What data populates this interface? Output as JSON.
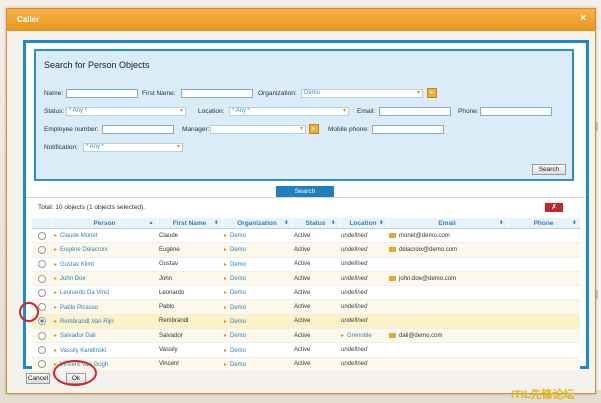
{
  "dialog": {
    "title": "Caller",
    "close": "×"
  },
  "search_panel": {
    "title": "Search for Person Objects",
    "labels": {
      "name": "Name:",
      "first_name": "First Name:",
      "organization": "Organization:",
      "status": "Status:",
      "location": "Location:",
      "email": "Email:",
      "phone": "Phone:",
      "employee_number": "Employee number:",
      "manager": "Manager:",
      "mobile_phone": "Mobile phone:",
      "notification": "Notification:"
    },
    "values": {
      "organization": "Demo",
      "status": "* Any *",
      "location": "* Any *",
      "notification": "* Any *",
      "name": "",
      "first_name": "",
      "email": "",
      "phone": "",
      "employee_number": "",
      "manager": "",
      "mobile_phone": ""
    },
    "search_button": "Search"
  },
  "search_tab": "Search",
  "results": {
    "total": "Total: 10 objects (1 objects selected).",
    "columns": [
      "Person",
      "First Name",
      "Organization",
      "Status",
      "Location",
      "Email",
      "Phone"
    ],
    "rows": [
      {
        "person": "Claude Monet",
        "first": "Claude",
        "org": "Demo",
        "status": "Active",
        "location": "undefined",
        "email": "monet@demo.com",
        "phone": "",
        "selected": false
      },
      {
        "person": "Eugène Delacroix",
        "first": "Eugène",
        "org": "Demo",
        "status": "Active",
        "location": "undefined",
        "email": "delacroix@demo.com",
        "phone": "",
        "selected": false
      },
      {
        "person": "Gustav Klimt",
        "first": "Gustav",
        "org": "Demo",
        "status": "Active",
        "location": "undefined",
        "email": "",
        "phone": "",
        "selected": false
      },
      {
        "person": "John Doe",
        "first": "John",
        "org": "Demo",
        "status": "Active",
        "location": "undefined",
        "email": "john.doe@demo.com",
        "phone": "",
        "selected": false
      },
      {
        "person": "Leonardo Da Vinci",
        "first": "Leonardo",
        "org": "Demo",
        "status": "Active",
        "location": "undefined",
        "email": "",
        "phone": "",
        "selected": false
      },
      {
        "person": "Pablo Picasso",
        "first": "Pablo",
        "org": "Demo",
        "status": "Active",
        "location": "undefined",
        "email": "",
        "phone": "",
        "selected": false
      },
      {
        "person": "Rembrandt Van Rijn",
        "first": "Rembrandt",
        "org": "Demo",
        "status": "Active",
        "location": "undefined",
        "email": "",
        "phone": "",
        "selected": true
      },
      {
        "person": "Salvador Dali",
        "first": "Salvador",
        "org": "Demo",
        "status": "Active",
        "location": "Grenoble",
        "email": "dali@demo.com",
        "phone": "",
        "selected": false
      },
      {
        "person": "Vassily Kandinski",
        "first": "Vassily",
        "org": "Demo",
        "status": "Active",
        "location": "undefined",
        "email": "",
        "phone": "",
        "selected": false
      },
      {
        "person": "Vincent Van Gogh",
        "first": "Vincent",
        "org": "Demo",
        "status": "Active",
        "location": "undefined",
        "email": "",
        "phone": "",
        "selected": false
      }
    ]
  },
  "footer": {
    "cancel": "Cancel",
    "ok": "Ok"
  },
  "watermark": "ITIL先锋论坛",
  "colors": {
    "accent": "#e8961c",
    "frame": "#1f8ac6",
    "link": "#2f80be",
    "highlight": "#d6222c"
  }
}
